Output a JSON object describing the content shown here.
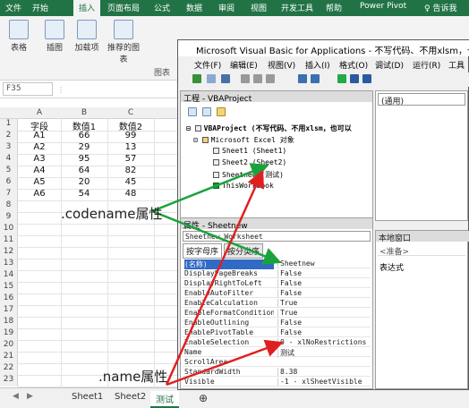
{
  "ribbon": {
    "tabs": [
      "文件",
      "开始",
      "插入",
      "页面布局",
      "公式",
      "数据",
      "审阅",
      "视图",
      "开发工具",
      "帮助",
      "Power Pivot",
      "告诉我"
    ],
    "active_tab": "插入",
    "groups": [
      {
        "label": "表格",
        "icon": "table-icon"
      },
      {
        "label": "插图",
        "icon": "image-icon"
      },
      {
        "label": "加载项",
        "icon": "addin-icon"
      },
      {
        "label": "推荐的图表",
        "icon": "chart-icon"
      }
    ],
    "group_footer": "图表"
  },
  "formula_bar": {
    "name_box": "F35"
  },
  "grid": {
    "columns": [
      "A",
      "B",
      "C"
    ],
    "row_numbers": [
      "1",
      "2",
      "3",
      "4",
      "5",
      "6",
      "7",
      "8",
      "9",
      "10",
      "11",
      "12",
      "13",
      "14",
      "15",
      "16",
      "17",
      "18",
      "19",
      "20",
      "21",
      "22",
      "23"
    ],
    "header": [
      "字段",
      "数值1",
      "数值2"
    ],
    "rows": [
      [
        "A1",
        "66",
        "99"
      ],
      [
        "A2",
        "29",
        "13"
      ],
      [
        "A3",
        "95",
        "57"
      ],
      [
        "A4",
        "64",
        "82"
      ],
      [
        "A5",
        "20",
        "45"
      ],
      [
        "A6",
        "54",
        "48"
      ]
    ]
  },
  "sheets": {
    "tabs": [
      "Sheet1",
      "Sheet2",
      "测试"
    ],
    "active": "测试",
    "add_symbol": "⊕"
  },
  "annotations": {
    "codename": ".codename属性",
    "name": ".name属性"
  },
  "vba": {
    "title": "Microsoft Visual Basic for Applications - 不写代码、不用xlsm，也可以有vba的",
    "menus": [
      "文件(F)",
      "编辑(E)",
      "视图(V)",
      "插入(I)",
      "格式(O)",
      "调试(D)",
      "运行(R)",
      "工具"
    ],
    "project_pane_title": "工程 - VBAProject",
    "tree": {
      "root": "VBAProject (不写代码、不用xlsm，也可以",
      "folder": "Microsoft Excel 对象",
      "items": [
        "Sheet1 (Sheet1)",
        "Sheet2 (Sheet2)",
        "Sheetnew (测试)",
        "ThisWorkbook"
      ]
    },
    "code_combo": "(通用)",
    "props_pane_title": "属性 - Sheetnew",
    "props_object": "Sheetnew Worksheet",
    "props_tabs": [
      "按字母序",
      "按分类序"
    ],
    "properties": [
      {
        "name": "(名称)",
        "value": "Sheetnew"
      },
      {
        "name": "DisplayPageBreaks",
        "value": "False"
      },
      {
        "name": "DisplayRightToLeft",
        "value": "False"
      },
      {
        "name": "EnableAutoFilter",
        "value": "False"
      },
      {
        "name": "EnableCalculation",
        "value": "True"
      },
      {
        "name": "EnableFormatConditionsCa",
        "value": "True"
      },
      {
        "name": "EnableOutlining",
        "value": "False"
      },
      {
        "name": "EnablePivotTable",
        "value": "False"
      },
      {
        "name": "EnableSelection",
        "value": "0 - xlNoRestrictions"
      },
      {
        "name": "Name",
        "value": "测试"
      },
      {
        "name": "ScrollArea",
        "value": ""
      },
      {
        "name": "StandardWidth",
        "value": "8.38"
      },
      {
        "name": "Visible",
        "value": "-1 - xlSheetVisible"
      }
    ],
    "immediate_title": "本地窗口",
    "immediate_head": "<准备>",
    "immediate_expr": "表达式"
  },
  "colors": {
    "excel_green": "#217346",
    "arrow_green": "#1aa33a",
    "arrow_red": "#e02020"
  }
}
